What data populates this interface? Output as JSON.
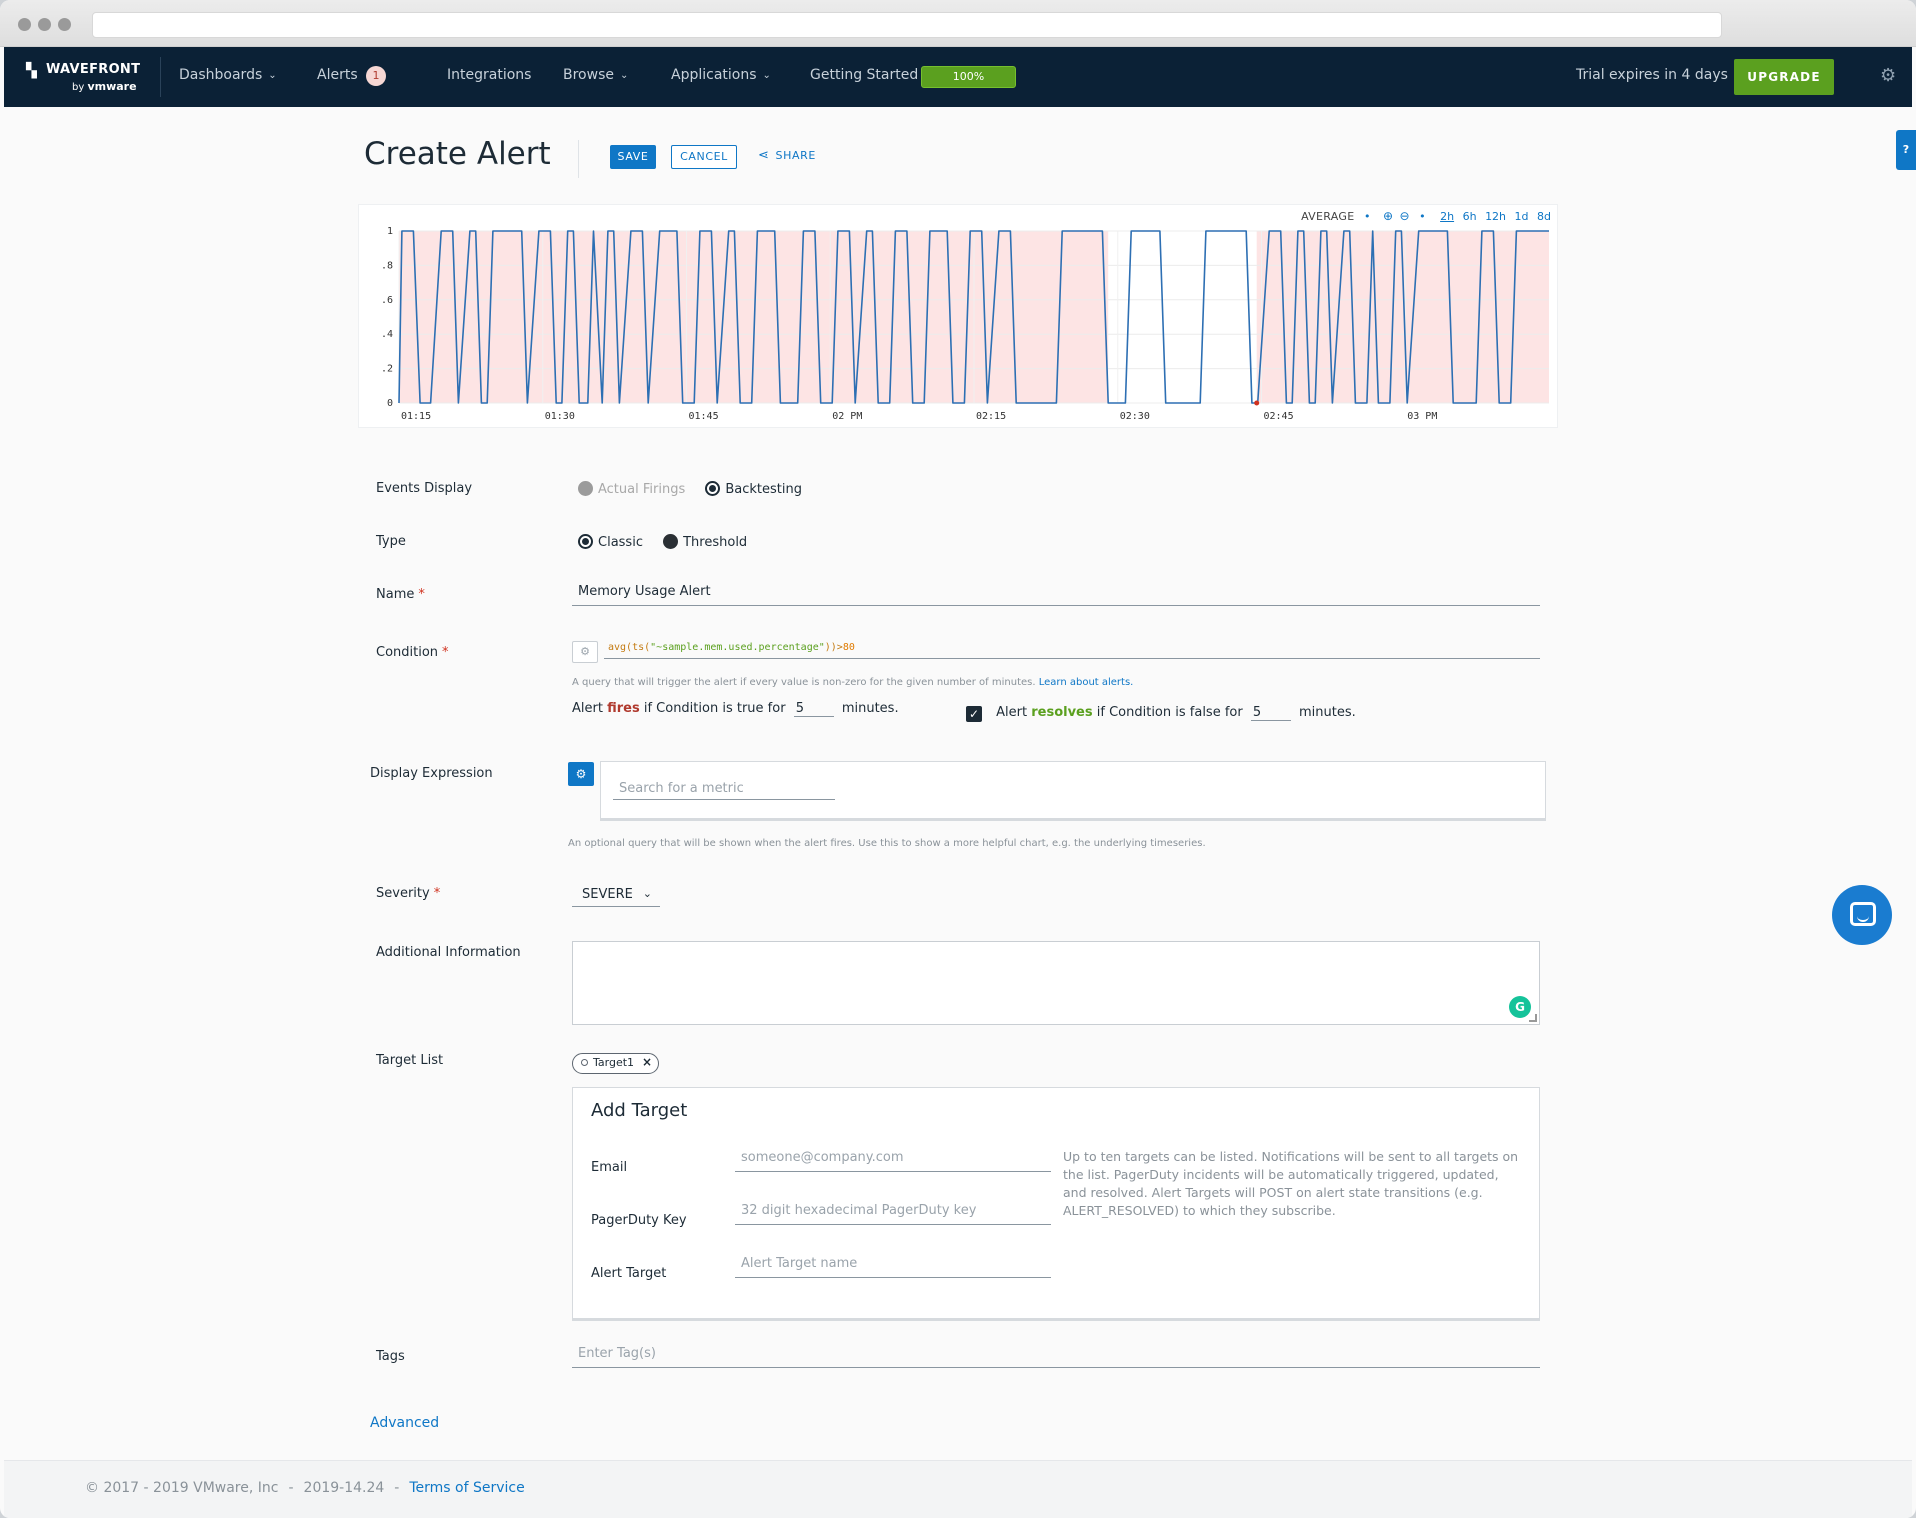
{
  "nav": {
    "brand_title": "WAVEFRONT",
    "brand_sub_prefix": "by",
    "brand_sub_name": "vmware",
    "dashboards": "Dashboards",
    "alerts": "Alerts",
    "alerts_count": "1",
    "integrations": "Integrations",
    "browse": "Browse",
    "applications": "Applications",
    "getting_started": "Getting Started",
    "progress_label": "100%",
    "trial": "Trial expires in 4 days",
    "upgrade": "UPGRADE"
  },
  "header": {
    "title": "Create Alert",
    "save": "SAVE",
    "cancel": "CANCEL",
    "share": "SHARE"
  },
  "chart": {
    "aggregation": "AVERAGE",
    "ranges": [
      "2h",
      "6h",
      "12h",
      "1d",
      "8d"
    ],
    "active_range": "2h"
  },
  "chart_data": {
    "type": "line",
    "title": "",
    "xlabel": "",
    "ylabel": "",
    "y_ticks": [
      "0",
      ".2",
      ".4",
      ".6",
      ".8",
      "1"
    ],
    "ylim": [
      0,
      1
    ],
    "x_ticks": [
      "01:15",
      "01:30",
      "01:45",
      "02 PM",
      "02:15",
      "02:30",
      "02:45",
      "03 PM"
    ],
    "x_range_minutes": [
      0,
      120
    ],
    "x_tick_minutes": [
      0,
      15,
      30,
      45,
      60,
      75,
      90,
      105
    ],
    "grid": true,
    "alert_bands_minutes": [
      [
        0,
        74
      ],
      [
        89.5,
        120
      ]
    ],
    "series": [
      {
        "color": "#2d6fb3",
        "points": [
          [
            0,
            0
          ],
          [
            0.3,
            1
          ],
          [
            1.5,
            1
          ],
          [
            2.2,
            0
          ],
          [
            3.3,
            0
          ],
          [
            4.4,
            1
          ],
          [
            5.6,
            1
          ],
          [
            6.2,
            0
          ],
          [
            7.4,
            1
          ],
          [
            8.0,
            1
          ],
          [
            8.6,
            0
          ],
          [
            9.2,
            0
          ],
          [
            9.8,
            1
          ],
          [
            12.8,
            1
          ],
          [
            13.4,
            0
          ],
          [
            14.6,
            1
          ],
          [
            15.8,
            1
          ],
          [
            16.4,
            0
          ],
          [
            17.0,
            0
          ],
          [
            17.6,
            1
          ],
          [
            18.2,
            1
          ],
          [
            18.8,
            0
          ],
          [
            19.7,
            0
          ],
          [
            20.3,
            1
          ],
          [
            21.2,
            0
          ],
          [
            21.8,
            1
          ],
          [
            22.4,
            1
          ],
          [
            23.0,
            0
          ],
          [
            24.2,
            1
          ],
          [
            25.4,
            1
          ],
          [
            26.0,
            0
          ],
          [
            27.2,
            1
          ],
          [
            29.0,
            1
          ],
          [
            29.6,
            0
          ],
          [
            30.8,
            0
          ],
          [
            31.4,
            1
          ],
          [
            32.6,
            1
          ],
          [
            33.2,
            0
          ],
          [
            34.4,
            1
          ],
          [
            35.0,
            1
          ],
          [
            35.6,
            0
          ],
          [
            36.8,
            0
          ],
          [
            37.4,
            1
          ],
          [
            39.2,
            1
          ],
          [
            39.8,
            0
          ],
          [
            41.6,
            0
          ],
          [
            42.2,
            1
          ],
          [
            43.4,
            1
          ],
          [
            44.0,
            0
          ],
          [
            45.2,
            0
          ],
          [
            45.8,
            1
          ],
          [
            47.0,
            1
          ],
          [
            47.6,
            0
          ],
          [
            48.8,
            1
          ],
          [
            49.4,
            1
          ],
          [
            50.0,
            0
          ],
          [
            51.2,
            0
          ],
          [
            51.8,
            1
          ],
          [
            53.0,
            1
          ],
          [
            53.6,
            0
          ],
          [
            54.8,
            0
          ],
          [
            55.4,
            1
          ],
          [
            57.2,
            1
          ],
          [
            57.8,
            0
          ],
          [
            59.0,
            0
          ],
          [
            59.6,
            1
          ],
          [
            60.8,
            1
          ],
          [
            61.4,
            0
          ],
          [
            62.6,
            1
          ],
          [
            63.8,
            1
          ],
          [
            64.4,
            0
          ],
          [
            68.6,
            0
          ],
          [
            69.2,
            1
          ],
          [
            73.4,
            1
          ],
          [
            74.0,
            0
          ],
          [
            75.8,
            0
          ],
          [
            76.4,
            1
          ],
          [
            79.4,
            1
          ],
          [
            80.0,
            0
          ],
          [
            83.6,
            0
          ],
          [
            84.2,
            1
          ],
          [
            88.4,
            1
          ],
          [
            89.0,
            0
          ],
          [
            89.6,
            0
          ],
          [
            90.8,
            1
          ],
          [
            92.0,
            1
          ],
          [
            92.6,
            0
          ],
          [
            93.2,
            0
          ],
          [
            93.8,
            1
          ],
          [
            94.4,
            1
          ],
          [
            95.0,
            0
          ],
          [
            95.6,
            0
          ],
          [
            96.2,
            1
          ],
          [
            96.8,
            1
          ],
          [
            97.4,
            0
          ],
          [
            98.6,
            1
          ],
          [
            99.2,
            1
          ],
          [
            99.8,
            0
          ],
          [
            101.0,
            0
          ],
          [
            101.6,
            1
          ],
          [
            102.2,
            0
          ],
          [
            103.4,
            0
          ],
          [
            104.0,
            1
          ],
          [
            104.6,
            1
          ],
          [
            105.2,
            0
          ],
          [
            106.4,
            1
          ],
          [
            109.4,
            1
          ],
          [
            110.0,
            0
          ],
          [
            112.4,
            0
          ],
          [
            113.0,
            1
          ],
          [
            114.2,
            1
          ],
          [
            114.8,
            0
          ],
          [
            116.0,
            0
          ],
          [
            116.6,
            1
          ],
          [
            120,
            1
          ]
        ]
      }
    ]
  },
  "form": {
    "events_display_label": "Events Display",
    "events_actual": "Actual Firings",
    "events_backtesting": "Backtesting",
    "type_label": "Type",
    "type_classic": "Classic",
    "type_threshold": "Threshold",
    "name_label": "Name",
    "name_value": "Memory Usage Alert",
    "condition_label": "Condition",
    "condition_fn_open": "avg(ts(",
    "condition_metric": "\"~sample.mem.used.percentage\"",
    "condition_fn_close": "))>",
    "condition_threshold": "80",
    "condition_hint": "A query that will trigger the alert if every value is non-zero for the given number of minutes.",
    "condition_hint_link": "Learn about alerts.",
    "fires_prefix": "Alert",
    "fires_word": "fires",
    "fires_middle": "if Condition is true for",
    "fires_minutes": "5",
    "fires_suffix": "minutes.",
    "resolves_prefix": "Alert",
    "resolves_word": "resolves",
    "resolves_middle": "if Condition is false for",
    "resolves_minutes": "5",
    "resolves_suffix": "minutes.",
    "display_expression_label": "Display Expression",
    "display_search_placeholder": "Search for a metric",
    "display_hint": "An optional query that will be shown when the alert fires. Use this to show a more helpful chart, e.g. the underlying timeseries.",
    "severity_label": "Severity",
    "severity_value": "SEVERE",
    "additional_info_label": "Additional Information",
    "target_list_label": "Target List",
    "target_chip": "Target1",
    "add_target_title": "Add Target",
    "email_label": "Email",
    "email_placeholder": "someone@company.com",
    "pagerduty_label": "PagerDuty Key",
    "pagerduty_placeholder": "32 digit hexadecimal PagerDuty key",
    "alert_target_label": "Alert Target",
    "alert_target_placeholder": "Alert Target name",
    "target_note": "Up to ten targets can be listed. Notifications will be sent to all targets on the list. PagerDuty incidents will be automatically triggered, updated, and resolved. Alert Targets will POST on alert state transitions (e.g. ALERT_RESOLVED) to which they subscribe.",
    "tags_label": "Tags",
    "tags_placeholder": "Enter Tag(s)",
    "advanced": "Advanced"
  },
  "footer": {
    "copyright": "© 2017 - 2019 VMware, Inc",
    "version": "2019-14.24",
    "terms": "Terms of Service"
  },
  "colors": {
    "nav_bg": "#0b2136",
    "primary": "#0f77c6",
    "success": "#5ba01f",
    "alert_band": "#fde4e4",
    "series": "#2d6fb3"
  }
}
